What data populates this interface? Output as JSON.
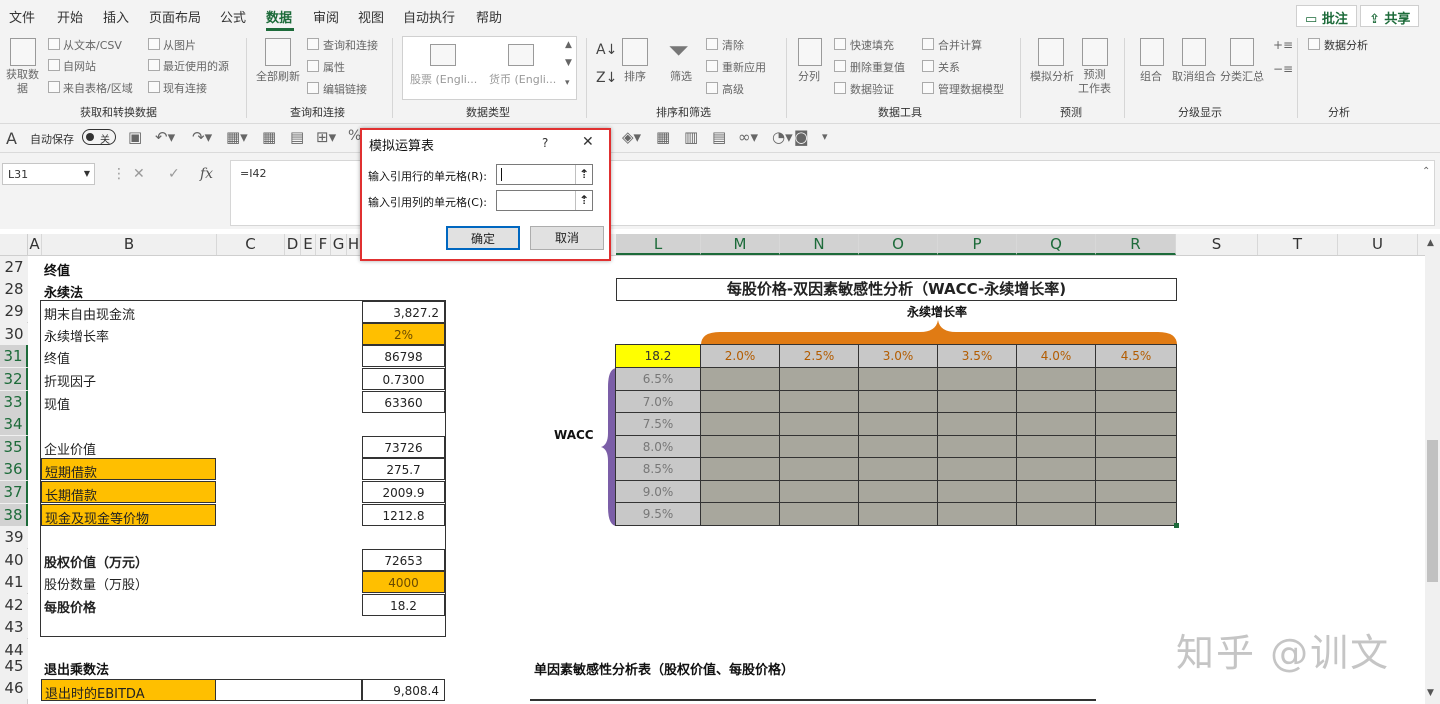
{
  "tabs": [
    "文件",
    "开始",
    "插入",
    "页面布局",
    "公式",
    "数据",
    "审阅",
    "视图",
    "自动执行",
    "帮助"
  ],
  "tab_right": {
    "comments": "批注",
    "share": "共享"
  },
  "ribbon": {
    "get_data": "获取数\n据",
    "from_text": "从文本/CSV",
    "from_web": "自网站",
    "from_table": "来自表格/区域",
    "from_picture": "从图片",
    "recent_sources": "最近使用的源",
    "existing_conn": "现有连接",
    "group1": "获取和转换数据",
    "refresh_all": "全部刷新",
    "queries_conn": "查询和连接",
    "properties": "属性",
    "edit_links": "编辑链接",
    "group2": "查询和连接",
    "stocks": "股票 (Engli...",
    "currency": "货币 (Engli...",
    "group3": "数据类型",
    "sort": "排序",
    "filter": "筛选",
    "clear": "清除",
    "reapply": "重新应用",
    "advanced": "高级",
    "group4": "排序和筛选",
    "split": "分列",
    "flash_fill": "快速填充",
    "remove_dup": "删除重复值",
    "validation": "数据验证",
    "consolidate": "合并计算",
    "relations": "关系",
    "manage_model": "管理数据模型",
    "group5": "数据工具",
    "whatif": "模拟分析",
    "forecast_sheet": "预测\n工作表",
    "group6": "预测",
    "group_btn": "组合",
    "ungroup": "取消组合",
    "subtotal": "分类汇总",
    "group7": "分级显示",
    "data_analysis": "数据分析",
    "group8": "分析"
  },
  "qat": {
    "autosave": "自动保存",
    "toggle": "关"
  },
  "formula_bar": {
    "name_box": "L31",
    "fx": "fx",
    "formula": "=I42"
  },
  "columns": [
    "A",
    "B",
    "C",
    "D",
    "E",
    "F",
    "G",
    "H",
    "L",
    "M",
    "N",
    "O",
    "P",
    "Q",
    "R",
    "S",
    "T",
    "U"
  ],
  "rows": [
    "27",
    "28",
    "29",
    "30",
    "31",
    "32",
    "33",
    "34",
    "35",
    "36",
    "37",
    "38",
    "39",
    "40",
    "41",
    "42",
    "43",
    "44",
    "45",
    "46"
  ],
  "sheet": {
    "r27": "终值",
    "r28": "永续法",
    "labels": [
      {
        "t": "期末自由现金流",
        "v": "3,827.2"
      },
      {
        "t": "永续增长率",
        "v": "2%"
      },
      {
        "t": "终值",
        "v": "86798"
      },
      {
        "t": "折现因子",
        "v": "0.7300"
      },
      {
        "t": "现值",
        "v": "63360"
      }
    ],
    "ev_label": "企业价值",
    "ev_value": "73726",
    "stb_label": "短期借款",
    "stb_value": "275.7",
    "ltb_label": "长期借款",
    "ltb_value": "2009.9",
    "cash_label": "现金及现金等价物",
    "cash_value": "1212.8",
    "eq_label": "股权价值（万元）",
    "eq_value": "72653",
    "shares_label": "股份数量（万股）",
    "shares_value": "4000",
    "pps_label": "每股价格",
    "pps_value": "18.2",
    "exit_title": "退出乘数法",
    "ebitda_label": "退出时的EBITDA",
    "ebitda_value": "9,808.4",
    "sens_title": "每股价格-双因素敏感性分析（WACC-永续增长率)",
    "growth_label": "永续增长率",
    "wacc_label": "WACC",
    "corner": "18.2",
    "growth_rates": [
      "2.0%",
      "2.5%",
      "3.0%",
      "3.5%",
      "4.0%",
      "4.5%"
    ],
    "wacc_rates": [
      "6.5%",
      "7.0%",
      "7.5%",
      "8.0%",
      "8.5%",
      "9.0%",
      "9.5%"
    ],
    "single_title": "单因素敏感性分析表（股权价值、每股价格）"
  },
  "dialog": {
    "title": "模拟运算表",
    "help": "?",
    "close": "✕",
    "row_label": "输入引用行的单元格(R):",
    "col_label": "输入引用列的单元格(C):",
    "ok": "确定",
    "cancel": "取消"
  },
  "watermark": "知乎 @训文",
  "colors": {
    "accent": "#1d6b3a",
    "orange": "#ffbf00",
    "brace_orange": "#e07b14",
    "brace_purple": "#7b5ea7",
    "table_gray": "#a8a79d",
    "dialog_border": "#e03030"
  }
}
